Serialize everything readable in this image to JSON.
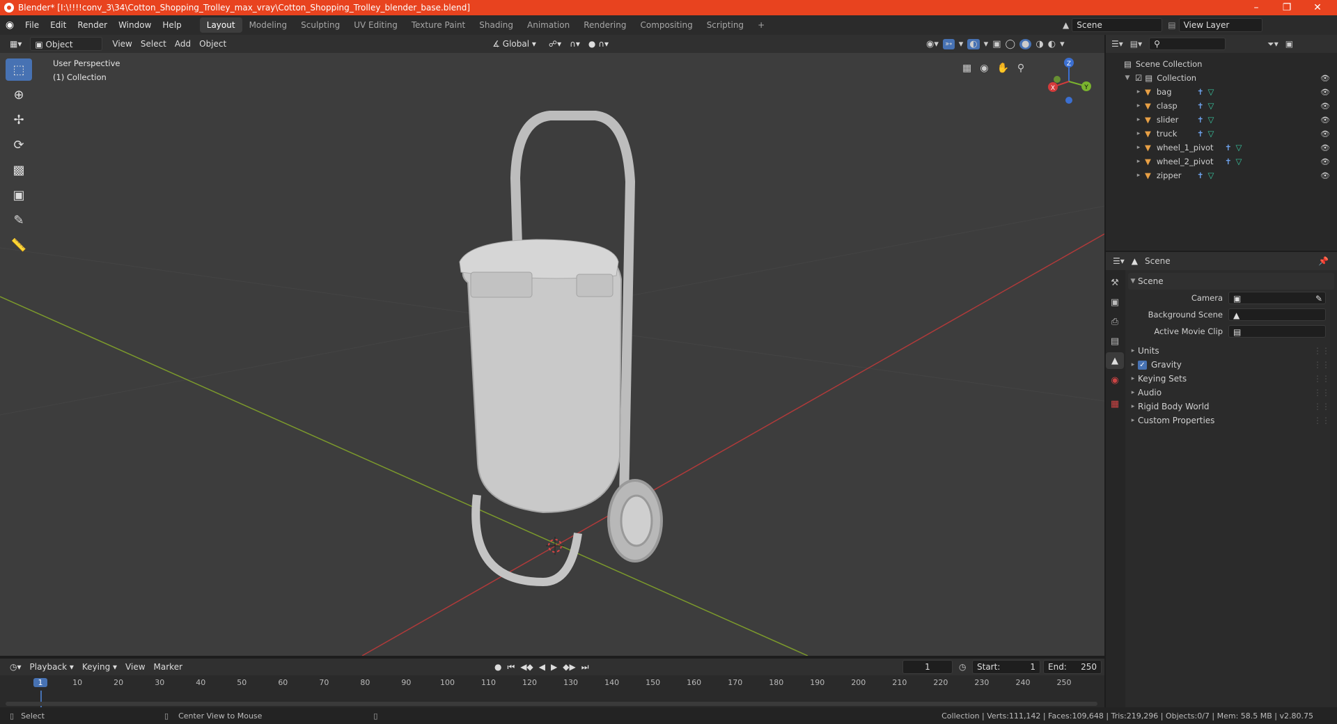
{
  "title_bar": {
    "text": "Blender* [I:\\!!!!conv_3\\34\\Cotton_Shopping_Trolley_max_vray\\Cotton_Shopping_Trolley_blender_base.blend]"
  },
  "menus": [
    "File",
    "Edit",
    "Render",
    "Window",
    "Help"
  ],
  "workspaces": [
    "Layout",
    "Modeling",
    "Sculpting",
    "UV Editing",
    "Texture Paint",
    "Shading",
    "Animation",
    "Rendering",
    "Compositing",
    "Scripting"
  ],
  "active_workspace": "Layout",
  "scene_field": "Scene",
  "view_layer_field": "View Layer",
  "viewport_header": {
    "mode": "Object Mode",
    "menus": [
      "View",
      "Select",
      "Add",
      "Object"
    ],
    "orientation": "Global"
  },
  "viewport": {
    "perspective": "User Perspective",
    "collection": "(1) Collection",
    "gizmo": {
      "x": "X",
      "y": "Y",
      "z": "Z"
    }
  },
  "outliner": {
    "root": "Scene Collection",
    "collection": "Collection",
    "objects": [
      "bag",
      "clasp",
      "slider",
      "truck",
      "wheel_1_pivot",
      "wheel_2_pivot",
      "zipper"
    ]
  },
  "properties": {
    "header": "Scene",
    "panel": "Scene",
    "fields": {
      "camera_label": "Camera",
      "background_label": "Background Scene",
      "movie_clip_label": "Active Movie Clip"
    },
    "sections": [
      "Units",
      "Gravity",
      "Keying Sets",
      "Audio",
      "Rigid Body World",
      "Custom Properties"
    ],
    "gravity_checked": true
  },
  "timeline": {
    "menus": [
      "Playback",
      "Keying",
      "View",
      "Marker"
    ],
    "current_frame": "1",
    "start_label": "Start:",
    "start": "1",
    "end_label": "End:",
    "end": "250",
    "ticks": [
      "1",
      "10",
      "20",
      "30",
      "40",
      "50",
      "60",
      "70",
      "80",
      "90",
      "100",
      "110",
      "120",
      "130",
      "140",
      "150",
      "160",
      "170",
      "180",
      "190",
      "200",
      "210",
      "220",
      "230",
      "240",
      "250"
    ]
  },
  "status_bar": {
    "select": "Select",
    "center": "Center View to Mouse",
    "stats": "Collection | Verts:111,142 | Faces:109,648 | Tris:219,296 | Objects:0/7 | Mem: 58.5 MB | v2.80.75"
  },
  "colors": {
    "title": "#e8431f",
    "accent": "#4772b3",
    "object_icon": "#e8a045",
    "mesh_icon": "#39c6a0",
    "modifier_icon": "#6fa4ef"
  }
}
